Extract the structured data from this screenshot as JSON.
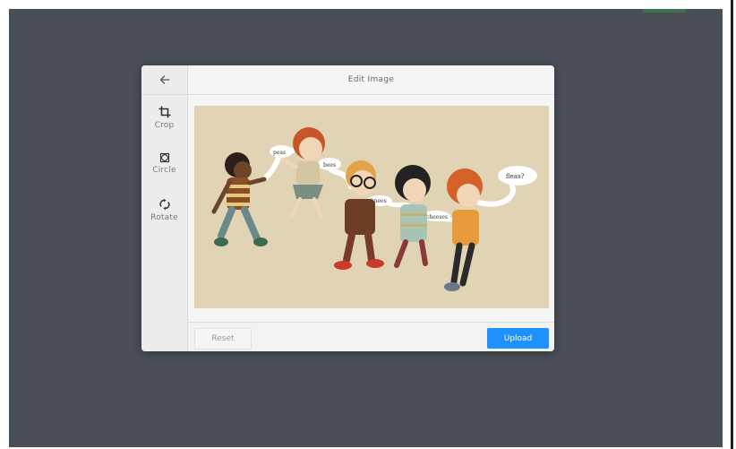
{
  "dialog": {
    "title": "Edit Image"
  },
  "sidebar": {
    "back_icon": "arrow-left-icon",
    "tools": [
      {
        "label": "Crop",
        "icon": "crop-icon"
      },
      {
        "label": "Circle",
        "icon": "circle-crop-icon"
      },
      {
        "label": "Rotate",
        "icon": "rotate-icon"
      }
    ]
  },
  "image": {
    "speech_words": [
      "peas",
      "bees",
      "knees",
      "fleas?",
      "cheeses"
    ]
  },
  "footer": {
    "reset_label": "Reset",
    "upload_label": "Upload"
  },
  "colors": {
    "background": "#4a4f57",
    "accent": "#1e90ff",
    "image_bg": "#e0d4b4"
  }
}
